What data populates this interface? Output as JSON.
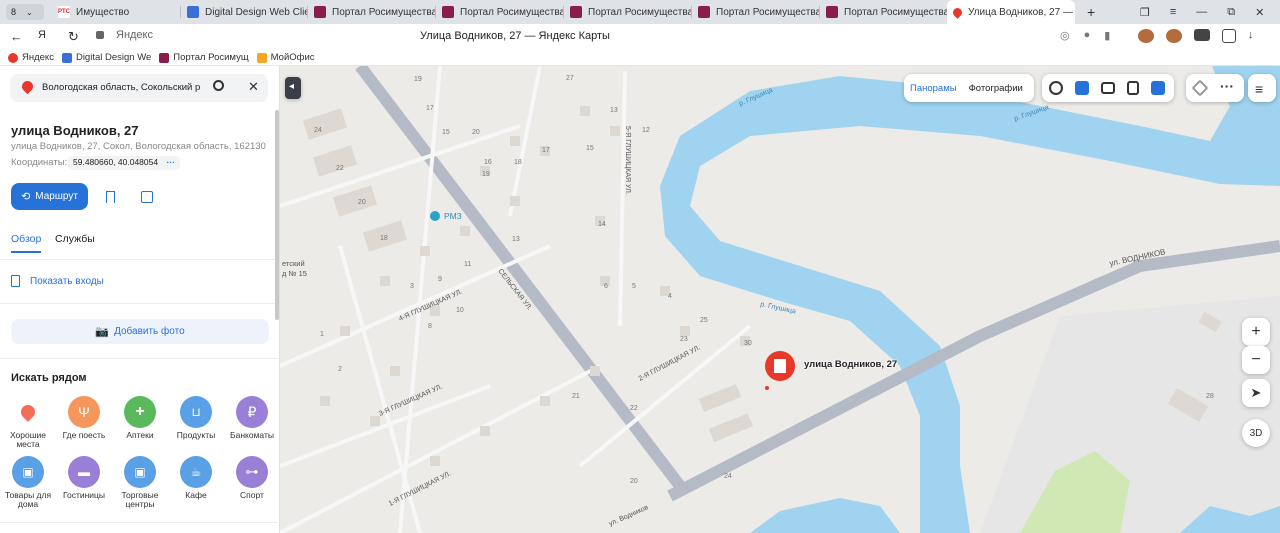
{
  "browser": {
    "tab_count": "8",
    "tabs": [
      {
        "label": "Имущество",
        "favicon_text": "РТС"
      },
      {
        "label": "Digital Design Web Clien"
      },
      {
        "label": "Портал Росимущества"
      },
      {
        "label": "Портал Росимущества"
      },
      {
        "label": "Портал Росимущества"
      },
      {
        "label": "Портал Росимущества"
      },
      {
        "label": "Портал Росимущества"
      },
      {
        "label": "Улица Водников, 27 —"
      }
    ],
    "page_title": "Улица Водников, 27 — Яндекс Карты",
    "address_host": "Яндекс",
    "bookmarks": [
      "Яндекс",
      "Digital Design We",
      "Портал Росимущ",
      "МойОфис"
    ]
  },
  "panel": {
    "search_value": "Вологодская область, Сокольский р",
    "place_title": "улица Водников, 27",
    "place_address": "улица Водников, 27, Сокол, Вологодская область, 162130",
    "coords_label": "Координаты:",
    "coords_value": "59.480660, 40.048054",
    "route_label": "Маршрут",
    "tabs": [
      "Обзор",
      "Службы"
    ],
    "entrances_label": "Показать входы",
    "add_photo_label": "Добавить фото",
    "nearby_title": "Искать рядом",
    "categories": [
      {
        "label": "Хорошие места",
        "color": "#f46d58"
      },
      {
        "label": "Где поесть",
        "color": "#f5975c"
      },
      {
        "label": "Аптеки",
        "color": "#5cb85c"
      },
      {
        "label": "Продукты",
        "color": "#5aa0e6"
      },
      {
        "label": "Банкоматы",
        "color": "#9a7fd6"
      },
      {
        "label": "Товары для дома",
        "color": "#5aa0e6"
      },
      {
        "label": "Гостиницы",
        "color": "#9a7fd6"
      },
      {
        "label": "Торговые центры",
        "color": "#5aa0e6"
      },
      {
        "label": "Кафе",
        "color": "#5aa0e6"
      },
      {
        "label": "Спорт",
        "color": "#9a7fd6"
      }
    ]
  },
  "map": {
    "controls": {
      "panoramas": "Панорамы",
      "photos": "Фотографии",
      "three_d": "3D"
    },
    "pin_label": "улица Водников, 27",
    "poi_label": "РМЗ",
    "street_labels": [
      "СЕЛЬСКАЯ УЛ.",
      "ул. ВОДНИКОВ",
      "ул. Водников",
      "5-Я ГЛУШИЦКАЯ УЛ.",
      "4-Я ГЛУШИЦКАЯ УЛ.",
      "3-Я ГЛУШИЦКАЯ УЛ.",
      "2-Я ГЛУШИЦКАЯ УЛ.",
      "1-Я ГЛУШИЦКАЯ УЛ.",
      "р. Глушица"
    ],
    "partial_label": "етский\nд № 15",
    "house_numbers": [
      "19",
      "17",
      "24",
      "15",
      "20",
      "22",
      "20",
      "18",
      "16",
      "27",
      "13",
      "12",
      "15",
      "17",
      "18",
      "19",
      "13",
      "11",
      "14",
      "10",
      "9",
      "8",
      "6",
      "5",
      "4",
      "3",
      "2",
      "1",
      "25",
      "23",
      "30",
      "22",
      "21",
      "20",
      "24",
      "28"
    ],
    "colors": {
      "water": "#9fd3ef",
      "road": "#b4bac6",
      "land": "#ecebe8",
      "building": "#ddd8d2",
      "park": "#cfe8b4",
      "pin": "#e8382b"
    }
  }
}
